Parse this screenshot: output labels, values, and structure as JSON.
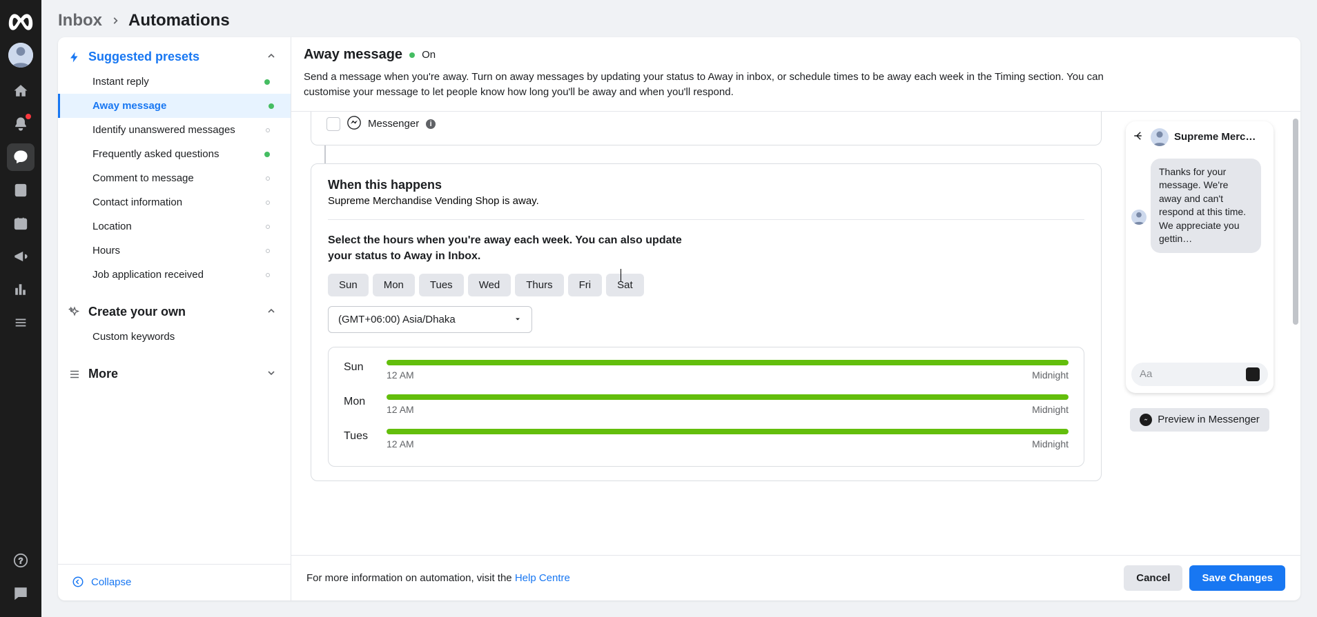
{
  "breadcrumb": {
    "parent": "Inbox",
    "current": "Automations"
  },
  "sidebar": {
    "presets_label": "Suggested presets",
    "items": [
      {
        "label": "Instant reply",
        "status": "green"
      },
      {
        "label": "Away message",
        "status": "green",
        "active": true
      },
      {
        "label": "Identify unanswered messages",
        "status": "grey"
      },
      {
        "label": "Frequently asked questions",
        "status": "green"
      },
      {
        "label": "Comment to message",
        "status": "grey"
      },
      {
        "label": "Contact information",
        "status": "grey"
      },
      {
        "label": "Location",
        "status": "grey"
      },
      {
        "label": "Hours",
        "status": "grey"
      },
      {
        "label": "Job application received",
        "status": "grey"
      }
    ],
    "create_your_own_label": "Create your own",
    "create_items": [
      {
        "label": "Custom keywords"
      }
    ],
    "more_label": "More",
    "collapse_label": "Collapse"
  },
  "header": {
    "title": "Away message",
    "status": "On",
    "description": "Send a message when you're away. Turn on away messages by updating your status to Away in inbox, or schedule times to be away each week in the Timing section. You can customise your message to let people know how long you'll be away and when you'll respond."
  },
  "messenger_option": {
    "label": "Messenger"
  },
  "when": {
    "title": "When this happens",
    "subtitle": "Supreme Merchandise Vending Shop is away.",
    "instruction": "Select the hours when you're away each week. You can also update your status to Away in Inbox.",
    "days": [
      "Sun",
      "Mon",
      "Tues",
      "Wed",
      "Thurs",
      "Fri",
      "Sat"
    ],
    "timezone": "(GMT+06:00) Asia/Dhaka",
    "schedule": [
      {
        "day": "Sun",
        "start": "12 AM",
        "end": "Midnight"
      },
      {
        "day": "Mon",
        "start": "12 AM",
        "end": "Midnight"
      },
      {
        "day": "Tues",
        "start": "12 AM",
        "end": "Midnight"
      }
    ]
  },
  "preview": {
    "name": "Supreme Merc…",
    "bubble_text": "Thanks for your message. We're away and can't respond at this time. We appreciate you gettin…",
    "input_placeholder": "Aa",
    "preview_button": "Preview in Messenger"
  },
  "footer": {
    "info_prefix": "For more information on automation, visit the ",
    "help_link": "Help Centre",
    "cancel": "Cancel",
    "save": "Save Changes"
  }
}
